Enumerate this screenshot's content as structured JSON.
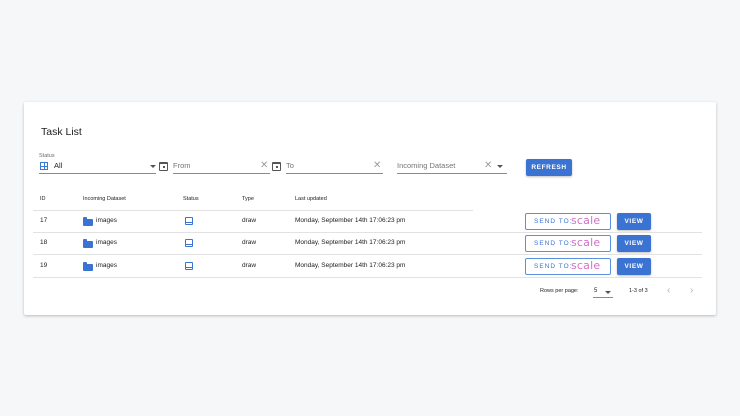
{
  "title": "Task List",
  "filters": {
    "status_label": "Status",
    "status_value": "All",
    "from_placeholder": "From",
    "to_placeholder": "To",
    "dataset_placeholder": "Incoming Dataset",
    "refresh_label": "REFRESH"
  },
  "table": {
    "headers": [
      "ID",
      "Incoming Dataset",
      "Status",
      "Type",
      "Last updated"
    ],
    "rows": [
      {
        "id": "17",
        "dataset": "images",
        "type": "draw",
        "updated": "Monday, September 14th 17:06:23 pm",
        "send_label": "SEND TO:",
        "send_logo": "scale",
        "view_label": "VIEW"
      },
      {
        "id": "18",
        "dataset": "images",
        "type": "draw",
        "updated": "Monday, September 14th 17:06:23 pm",
        "send_label": "SEND TO:",
        "send_logo": "scale",
        "view_label": "VIEW"
      },
      {
        "id": "19",
        "dataset": "images",
        "type": "draw",
        "updated": "Monday, September 14th 17:06:23 pm",
        "send_label": "SEND TO:",
        "send_logo": "scale",
        "view_label": "VIEW"
      }
    ]
  },
  "footer": {
    "rows_per_page_label": "Rows per page:",
    "rows_per_page_value": "5",
    "range": "1-3 of 3"
  },
  "icons": {
    "status": "select-all-icon",
    "calendar": "calendar-icon",
    "clear": "clear-icon",
    "folder": "folder-icon",
    "status_row": "inbox-icon",
    "prev": "chevron-left-icon",
    "next": "chevron-right-icon"
  },
  "colors": {
    "primary": "#3a73d1",
    "scale_logo": "#d46fc9",
    "background": "#f6f7f9"
  }
}
